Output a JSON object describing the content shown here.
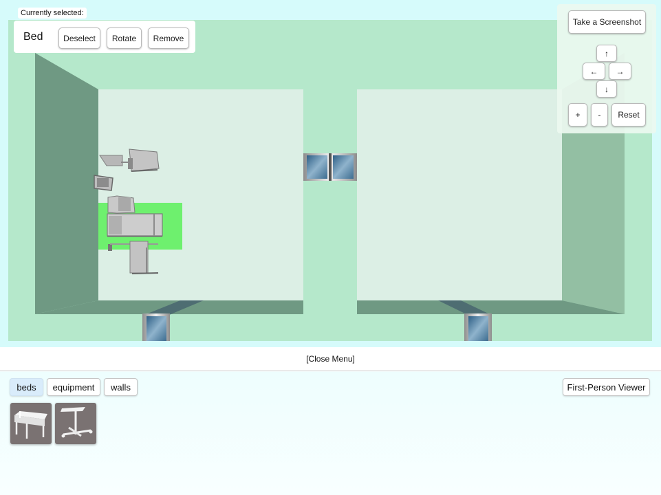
{
  "selection": {
    "heading": "Currently selected:",
    "item_name": "Bed",
    "deselect_label": "Deselect",
    "rotate_label": "Rotate",
    "remove_label": "Remove"
  },
  "camera_controls": {
    "screenshot_label": "Take a Screenshot",
    "up_label": "↑",
    "left_label": "←",
    "right_label": "→",
    "down_label": "↓",
    "zoom_in_label": "+",
    "zoom_out_label": "-",
    "reset_label": "Reset"
  },
  "menu": {
    "toggle_label": "[Close Menu]"
  },
  "catalog": {
    "tabs": [
      {
        "label": "beds",
        "active": true
      },
      {
        "label": "equipment",
        "active": false
      },
      {
        "label": "walls",
        "active": false
      }
    ],
    "viewer_label": "First-Person Viewer",
    "items": [
      {
        "icon": "hospital-bed-icon"
      },
      {
        "icon": "overbed-table-icon"
      }
    ]
  },
  "colors": {
    "floor": "#b5e8cb",
    "room_floor": "#dcf0e6",
    "wall_dark": "#6f9983",
    "wall_right": "#93bfa3",
    "selection_highlight": "#6ef06e",
    "viewport_bg": "#d6fbfb",
    "thumbnail_bg": "#7a7272"
  }
}
